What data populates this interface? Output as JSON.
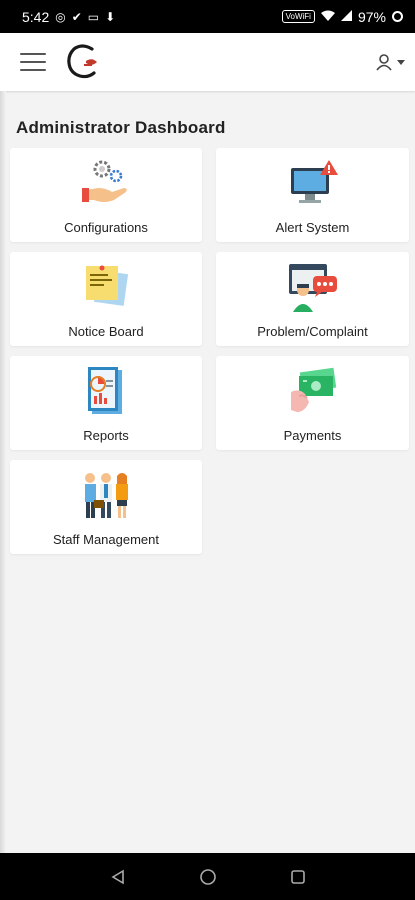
{
  "status_bar": {
    "time": "5:42",
    "battery": "97%",
    "network_badge": "VoWiFi"
  },
  "app_bar": {
    "menu_icon": "hamburger-icon",
    "logo_icon": "brand-logo-icon",
    "profile_icon": "user-icon"
  },
  "page": {
    "title": "Administrator Dashboard"
  },
  "tiles": [
    {
      "label": "Configurations",
      "icon": "configuration-gears-hand-icon"
    },
    {
      "label": "Alert System",
      "icon": "monitor-alert-icon"
    },
    {
      "label": "Notice Board",
      "icon": "sticky-notes-icon"
    },
    {
      "label": "Problem/Complaint",
      "icon": "support-chat-icon"
    },
    {
      "label": "Reports",
      "icon": "report-document-icon"
    },
    {
      "label": "Payments",
      "icon": "cash-hand-icon"
    },
    {
      "label": "Staff Management",
      "icon": "staff-group-icon"
    }
  ],
  "colors": {
    "background": "#f3f3f3",
    "card": "#ffffff",
    "title_text": "#222222",
    "logo_red": "#c0392b"
  },
  "nav_bar": {
    "back_icon": "back-triangle-icon",
    "home_icon": "home-circle-icon",
    "recents_icon": "recents-square-icon"
  }
}
